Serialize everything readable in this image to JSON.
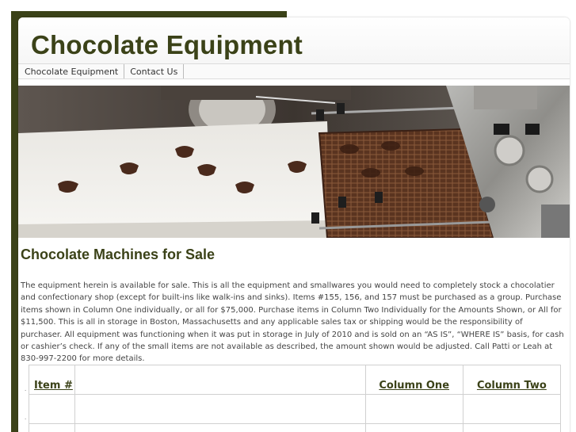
{
  "site": {
    "title": "Chocolate Equipment"
  },
  "nav": {
    "items": [
      {
        "label": "Chocolate Equipment"
      },
      {
        "label": "Contact Us"
      }
    ]
  },
  "hero": {
    "alt": "Chocolate enrobing machine conveyor with chocolates"
  },
  "main": {
    "heading": "Chocolate Machines for Sale",
    "intro": "The equipment herein is available for sale. This is all the equipment and smallwares you would need to completely stock a chocolatier and confectionary shop (except for built-ins like walk-ins and sinks). Items #155, 156, and 157 must be purchased as a group. Purchase items shown in Column One individually, or all for $75,000. Purchase items in Column Two Individually for the Amounts Shown, or All for $11,500. This is all in storage in Boston, Massachusetts and any applicable sales tax or shipping would be the responsibility of purchaser. All equipment was functioning when it was put in storage in July of 2010 and is sold on an “AS IS”, “WHERE IS” basis, for cash or cashier’s check. If any of the small items are not available as described, the amount shown would be adjusted. Call Patti or Leah at 830-997-2200 for more details."
  },
  "table": {
    "headers": {
      "item": "Item #",
      "description": "",
      "column_one": "Column One",
      "column_two": "Column Two"
    }
  },
  "colors": {
    "brand": "#3b4218",
    "background": "#ffffff"
  }
}
